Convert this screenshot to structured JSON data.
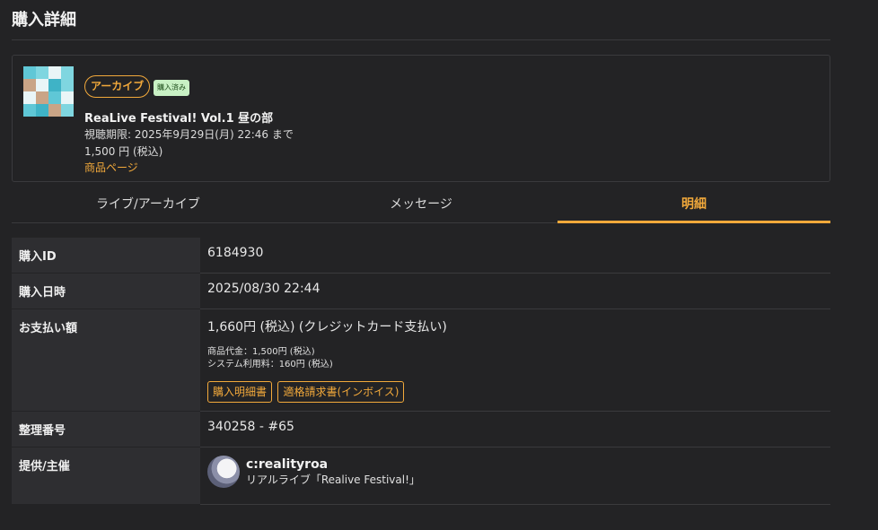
{
  "page": {
    "title": "購入詳細"
  },
  "product": {
    "status_badge": "アーカイブ",
    "purchased_badge": "購入済み",
    "name": "ReaLive Festival! Vol.1 昼の部",
    "viewing_period": "視聴期限: 2025年9月29日(月) 22:46 まで",
    "price": "1,500 円 (税込)",
    "product_page_link": "商品ページ"
  },
  "tabs": [
    {
      "label": "ライブ/アーカイブ",
      "active": false
    },
    {
      "label": "メッセージ",
      "active": false
    },
    {
      "label": "明細",
      "active": true
    }
  ],
  "details": {
    "purchase_id": {
      "label": "購入ID",
      "value": "6184930"
    },
    "purchase_datetime": {
      "label": "購入日時",
      "value": "2025/08/30 22:44"
    },
    "payment": {
      "label": "お支払い額",
      "value": "1,660円 (税込) (クレジットカード支払い)",
      "item_price": "商品代金：1,500円 (税込)",
      "system_fee": "システム利用料：160円 (税込)",
      "receipt_button": "購入明細書",
      "invoice_button": "適格請求書(インボイス)"
    },
    "reference_number": {
      "label": "整理番号",
      "value": "340258 - #65"
    },
    "provider": {
      "label": "提供/主催",
      "name": "c:realityroa",
      "event": "リアルライブ「Realive Festival!」"
    }
  },
  "colors": {
    "accent": "#f2a93b",
    "background": "#232325",
    "label_bg": "#2e2e31"
  }
}
